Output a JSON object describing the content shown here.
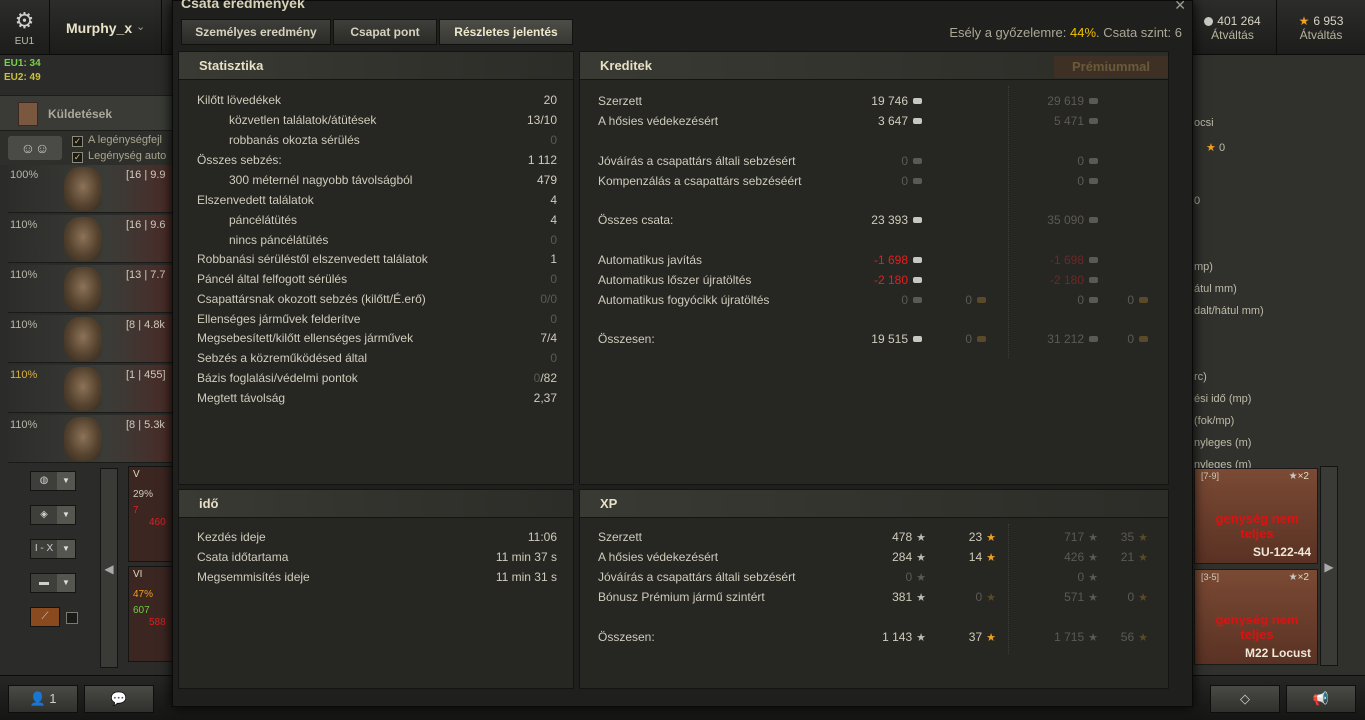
{
  "topbar": {
    "server": "EU1",
    "player": "Murphy_x",
    "silver": {
      "value": "401 264",
      "label": "Átváltás"
    },
    "gold": {
      "value": "6 953",
      "label": "Átváltás"
    }
  },
  "left": {
    "eu1": "EU1: 34",
    "eu2": "EU2: 49",
    "missions": "Küldetések",
    "crew_opt1": "A legénységfejl",
    "crew_opt2": "Legénység auto",
    "crew": [
      {
        "pct": "100%",
        "rank": "[16 | 9.9"
      },
      {
        "pct": "110%",
        "rank": "[16 | 9.6"
      },
      {
        "pct": "110%",
        "rank": "[13 | 7.7"
      },
      {
        "pct": "110%",
        "rank": "[8 | 4.8k"
      },
      {
        "pct": "110%",
        "rank": "[1 | 455]"
      },
      {
        "pct": "110%",
        "rank": "[8 | 5.3k"
      }
    ],
    "tier_filter": "I - X",
    "card1": {
      "tier": "V",
      "pct": "29%",
      "n1": "7",
      "n2": "460"
    },
    "card2": {
      "tier": "VI",
      "pct": "47%",
      "n1": "607",
      "n2": "588"
    }
  },
  "right": {
    "t1": "ocsi",
    "t2": "0",
    "t3": "0",
    "t4": "mp)",
    "t5": "átul mm)",
    "t6": "dalt/hátul mm)",
    "t7": "rc)",
    "t8": "ési idő (mp)",
    "t9": "(fok/mp)",
    "t10": "nyleges (m)",
    "t11": "nyleges (m)",
    "veh1": {
      "tier": "[7-9]",
      "x2": "×2",
      "warning": "genység nem teljes",
      "name": "SU-122-44"
    },
    "veh2": {
      "tier": "[3-5]",
      "x2": "×2",
      "warning": "genység nem teljes",
      "name": "M22 Locust"
    }
  },
  "bottombar": {
    "platoon_count": "1"
  },
  "dialog": {
    "title": "Csata eredmények",
    "tabs": [
      "Személyes eredmény",
      "Csapat pont",
      "Részletes jelentés"
    ],
    "chance_label": "Esély a győzelemre: ",
    "chance_value": "44%",
    "battle_level": ". Csata szint: 6",
    "stats": {
      "header": "Statisztika",
      "rows": [
        {
          "label": "Kilőtt lövedékek",
          "value": "20"
        },
        {
          "label": "közvetlen találatok/átütések",
          "value": "13/10"
        },
        {
          "label": "robbanás okozta sérülés",
          "value": "0"
        },
        {
          "label": "Összes sebzés:",
          "value": "1 112"
        },
        {
          "label": "300 méternél nagyobb távolságból",
          "value": "479"
        },
        {
          "label": "Elszenvedett találatok",
          "value": "4"
        },
        {
          "label": "páncélátütés",
          "value": "4"
        },
        {
          "label": "nincs páncélátütés",
          "value": "0"
        },
        {
          "label": "Robbanási sérüléstől elszenvedett találatok",
          "value": "1"
        },
        {
          "label": "Páncél által felfogott sérülés",
          "value": "0"
        },
        {
          "label": "Csapattársnak okozott sebzés (kilőtt/É.erő)",
          "value": "0/0"
        },
        {
          "label": "Ellenséges járművek felderítve",
          "value": "0"
        },
        {
          "label": "Megsebesített/kilőtt ellenséges járművek",
          "value": "7/4"
        },
        {
          "label": "Sebzés a közreműködésed által",
          "value": "0"
        },
        {
          "label": "Bázis foglalási/védelmi pontok",
          "value_a": "0",
          "value_b": "/82"
        },
        {
          "label": "Megtett távolság",
          "value": "2,37"
        }
      ]
    },
    "credits": {
      "header": "Kreditek",
      "premium_header": "Prémiummal",
      "rows": [
        {
          "label": "Szerzett",
          "v": "19 746",
          "p": "29 619"
        },
        {
          "label": "A hősies védekezésért",
          "v": "3 647",
          "p": "5 471"
        },
        {
          "label": "Jóváírás a csapattárs általi sebzésért",
          "v": "0",
          "p": "0"
        },
        {
          "label": "Kompenzálás a csapattárs sebzéséért",
          "v": "0",
          "p": "0"
        },
        {
          "label": "Összes csata:",
          "v": "23 393",
          "p": "35 090"
        },
        {
          "label": "Automatikus javítás",
          "v": "-1 698",
          "p": "-1 698"
        },
        {
          "label": "Automatikus lőszer újratöltés",
          "v": "-2 180",
          "p": "-2 180"
        },
        {
          "label": "Automatikus fogyócikk újratöltés",
          "v": "0",
          "g": "0",
          "p": "0",
          "pg": "0"
        },
        {
          "label": "Összesen:",
          "v": "19 515",
          "g": "0",
          "p": "31 212",
          "pg": "0"
        }
      ]
    },
    "time": {
      "header": "idő",
      "rows": [
        {
          "label": "Kezdés ideje",
          "value": "11:06"
        },
        {
          "label": "Csata időtartama",
          "value": "11 min 37 s"
        },
        {
          "label": "Megsemmisítés ideje",
          "value": "11 min 31 s"
        }
      ]
    },
    "xp": {
      "header": "XP",
      "rows": [
        {
          "label": "Szerzett",
          "v": "478",
          "f": "23",
          "p": "717",
          "pf": "35"
        },
        {
          "label": "A hősies védekezésért",
          "v": "284",
          "f": "14",
          "p": "426",
          "pf": "21"
        },
        {
          "label": "Jóváírás a csapattárs általi sebzésért",
          "v": "0",
          "p": "0"
        },
        {
          "label": "Bónusz Prémium jármű szintért",
          "v": "381",
          "f": "0",
          "p": "571",
          "pf": "0"
        },
        {
          "label": "Összesen:",
          "v": "1 143",
          "f": "37",
          "p": "1 715",
          "pf": "56"
        }
      ]
    }
  }
}
